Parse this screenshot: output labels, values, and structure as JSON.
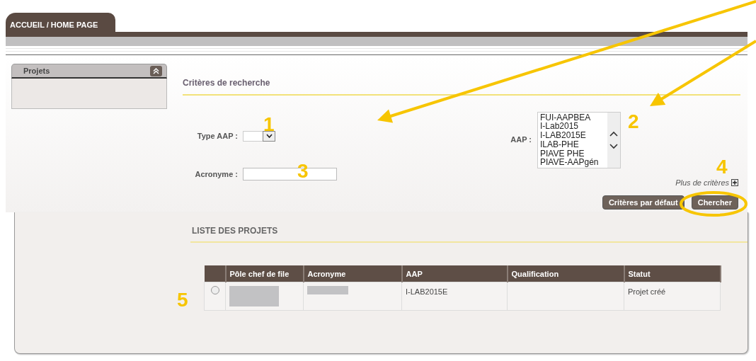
{
  "tabs": [
    {
      "label": "ACCUEIL / HOME PAGE",
      "selected": true
    }
  ],
  "sidebar": {
    "panels": [
      {
        "title": "Projets",
        "expanded": true
      }
    ]
  },
  "search": {
    "title": "Critères de recherche",
    "type_aap": {
      "label": "Type AAP :"
    },
    "aap": {
      "label": "AAP :",
      "options": [
        {
          "label": "FUI-AAPBEA",
          "selected": false
        },
        {
          "label": "I-Lab2015",
          "selected": false
        },
        {
          "label": "I-LAB2015E",
          "selected": false
        },
        {
          "label": "ILAB-PHE",
          "selected": false
        },
        {
          "label": "PIAVE PHE",
          "selected": false
        },
        {
          "label": "PIAVE-AAPgén",
          "selected": false
        }
      ]
    },
    "acronyme": {
      "label": "Acronyme :"
    },
    "more_link": "Plus de critères",
    "buttons": [
      "Critères par défaut",
      "Chercher"
    ]
  },
  "list": {
    "title": "LISTE DES PROJETS",
    "columns": [
      "Pôle chef de file",
      "Acronyme",
      "AAP",
      "Qualification",
      "Statut"
    ],
    "rows": [
      {
        "selected": false,
        "cells": [
          {
            "kind": "redacted"
          },
          {
            "kind": "redacted"
          },
          {
            "kind": "text",
            "text": "I-LAB2015E"
          },
          {
            "kind": "empty"
          },
          {
            "kind": "text",
            "text": "Projet créé"
          }
        ]
      }
    ]
  },
  "annotations": [
    {
      "kind": "arrow"
    },
    {
      "kind": "arrow"
    },
    {
      "kind": "ellipse"
    },
    {
      "kind": "number",
      "text": "1"
    },
    {
      "kind": "number",
      "text": "2"
    },
    {
      "kind": "number",
      "text": "3"
    },
    {
      "kind": "number",
      "text": "4"
    },
    {
      "kind": "number",
      "text": "5"
    }
  ]
}
